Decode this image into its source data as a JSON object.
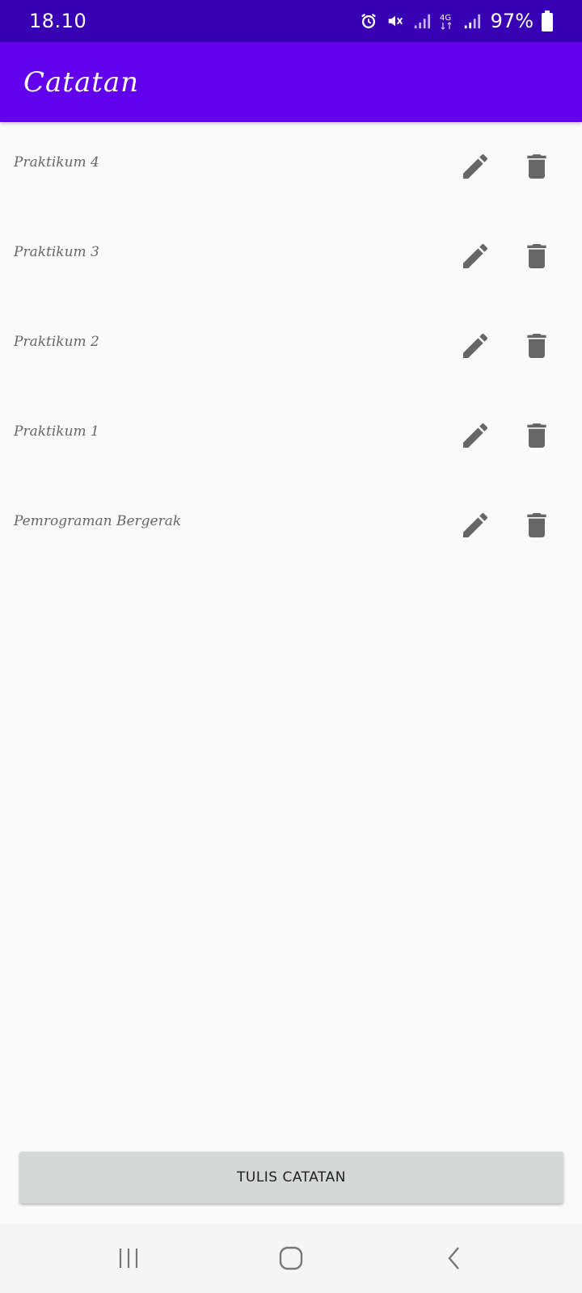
{
  "status_bar": {
    "time": "18.10",
    "battery": "97%",
    "icons": [
      "alarm-icon",
      "mute-icon",
      "signal-icon",
      "4g-icon",
      "signal-icon",
      "battery-icon"
    ]
  },
  "app_bar": {
    "title": "Catatan"
  },
  "notes": [
    {
      "title": "Praktikum 4"
    },
    {
      "title": "Praktikum 3"
    },
    {
      "title": "Praktikum 2"
    },
    {
      "title": "Praktikum 1"
    },
    {
      "title": "Pemrograman Bergerak"
    }
  ],
  "actions": {
    "write_label": "TULIS CATATAN",
    "edit_icon": "pencil-icon",
    "delete_icon": "trash-icon"
  },
  "nav_bar": {
    "icons": [
      "recent-apps-icon",
      "home-icon",
      "back-icon"
    ]
  },
  "colors": {
    "status_bar": "#3700b3",
    "app_bar": "#6200ee",
    "background": "#fafafa",
    "icon": "#666666",
    "button": "#d6d7d7"
  }
}
